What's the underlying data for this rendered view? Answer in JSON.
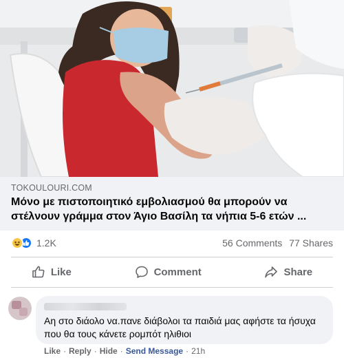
{
  "preview": {
    "domain": "TOKOULOURI.COM",
    "headline": "Μόνο με πιστοποιητικό εμβολιασμού θα μπορούν να στέλνουν γράμμα στον Άγιο Βασίλη τα νήπια 5-6 ετών ..."
  },
  "reactions": {
    "icons": [
      "haha-icon",
      "like-icon"
    ],
    "count": "1.2K",
    "comments": "56 Comments",
    "shares": "77 Shares"
  },
  "actions": {
    "like": "Like",
    "comment": "Comment",
    "share": "Share"
  },
  "comment": {
    "text": "Αη στο διάολο να.πανε διάβολοι τα παιδιά μας αφήστε τα ήσυχα που θα τους κάνετε ρομπότ ηλιθιοι",
    "like": "Like",
    "reply": "Reply",
    "hide": "Hide",
    "send_message": "Send Message",
    "separator": "·",
    "time": "21h"
  },
  "colors": {
    "accent": "#1877f2",
    "secondary_text": "#65676b",
    "send_message": "#385898",
    "preview_bg": "#f0f2f5"
  }
}
